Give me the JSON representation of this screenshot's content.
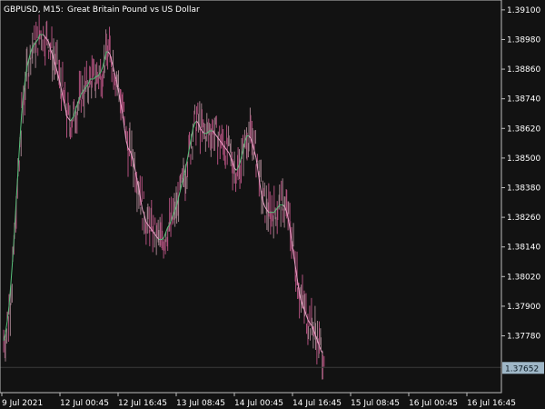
{
  "header": {
    "symbol": "GBPUSD, M15:",
    "description": "Great Britain Pound vs US Dollar"
  },
  "colors": {
    "background": "#121212",
    "axis": "#bdbdbd",
    "bar_up": "#a07f8a",
    "bar_down": "#b0507d",
    "ma_up": "#57c07a",
    "ma_down": "#e8a0c5",
    "price_line": "#3a3a3a",
    "price_tag": "#9fb7c7"
  },
  "price_axis": {
    "labels": [
      "1.39100",
      "1.38980",
      "1.38860",
      "1.38740",
      "1.38620",
      "1.38500",
      "1.38380",
      "1.38260",
      "1.38140",
      "1.38020",
      "1.37900",
      "1.37780"
    ]
  },
  "time_axis": {
    "labels": [
      "9 Jul 2021",
      "12 Jul 00:45",
      "12 Jul 16:45",
      "13 Jul 08:45",
      "14 Jul 00:45",
      "14 Jul 16:45",
      "15 Jul 08:45",
      "16 Jul 00:45",
      "16 Jul 16:45"
    ]
  },
  "current_price": "1.37652",
  "chart_data": {
    "type": "line",
    "ylim": [
      1.3755,
      1.3914
    ],
    "x": [
      0,
      2,
      4,
      6,
      8,
      10,
      12,
      14,
      16,
      18,
      20,
      22,
      24,
      26,
      28,
      30,
      32,
      34,
      36,
      38,
      40,
      42,
      44,
      46,
      48,
      50,
      52,
      54,
      56,
      58,
      60,
      62,
      64,
      66,
      68,
      70,
      72,
      74,
      76,
      78,
      80,
      82,
      84,
      86,
      88,
      90,
      92,
      94,
      96,
      98,
      100,
      102,
      104,
      106,
      108,
      110,
      112,
      114,
      116,
      118,
      120,
      122,
      124,
      126,
      128,
      130,
      132,
      134,
      136,
      138,
      140,
      142,
      144,
      146,
      148,
      150,
      152,
      154,
      156,
      158,
      160,
      162,
      164,
      166,
      168,
      170,
      172,
      174,
      176,
      178,
      180,
      182,
      184,
      186,
      188,
      190,
      192,
      194,
      196,
      198,
      200,
      202,
      204,
      206,
      208,
      210,
      212,
      214,
      216,
      218,
      220,
      222,
      224,
      226,
      228,
      230,
      232,
      234,
      236,
      238,
      240,
      242,
      244,
      246,
      248,
      250,
      252,
      254,
      256,
      258,
      260,
      262,
      264,
      266,
      268,
      270,
      272,
      274,
      276,
      278,
      280,
      282,
      284,
      286,
      288,
      290,
      292,
      294,
      296,
      298,
      300,
      302,
      304,
      306,
      308,
      310,
      312,
      314,
      316,
      318,
      320,
      322,
      324,
      326,
      328,
      330,
      332,
      334,
      336,
      338,
      340,
      342,
      344,
      346,
      348,
      350,
      352,
      354,
      356,
      358,
      360,
      362,
      364,
      366,
      368,
      370,
      372,
      374,
      376,
      378,
      380,
      382,
      384,
      386,
      388,
      390,
      392,
      394,
      396,
      398,
      400,
      402,
      404,
      406,
      408,
      410,
      412,
      414,
      416,
      418,
      420,
      422,
      424,
      426,
      428,
      430,
      432,
      434,
      436,
      438,
      440,
      442,
      444,
      446,
      448,
      450,
      452,
      454,
      456,
      458,
      460,
      462,
      464,
      466,
      468,
      470,
      472,
      474,
      476,
      478,
      480,
      482,
      484,
      486,
      488,
      490,
      492,
      494,
      496,
      498,
      500,
      502,
      504,
      506,
      508,
      510,
      512,
      514,
      516,
      518,
      520,
      522,
      524,
      526,
      528,
      530,
      532,
      534,
      536,
      538,
      540,
      542,
      544,
      546,
      548
    ],
    "series": [
      {
        "values": [
          1.3776,
          1.3779,
          1.3784,
          1.379,
          1.3799,
          1.3809,
          1.382,
          1.3833,
          1.3845,
          1.3857,
          1.3868,
          1.3876,
          1.3882,
          1.3887,
          1.389,
          1.3893,
          1.3895,
          1.3896,
          1.3897,
          1.3898,
          1.39,
          1.39,
          1.39,
          1.3899,
          1.3898,
          1.3897,
          1.3894,
          1.3892,
          1.3889,
          1.3887,
          1.3884,
          1.3881,
          1.3878,
          1.3874,
          1.3871,
          1.3867,
          1.3866,
          1.3865,
          1.3866,
          1.3867,
          1.387,
          1.3872,
          1.3874,
          1.3876,
          1.3877,
          1.3878,
          1.3879,
          1.388,
          1.3882,
          1.3882,
          1.3882,
          1.3883,
          1.3883,
          1.3884,
          1.3885,
          1.3887,
          1.389,
          1.3893,
          1.3893,
          1.3892,
          1.3889,
          1.3886,
          1.3883,
          1.388,
          1.3876,
          1.3872,
          1.3868,
          1.3862,
          1.3857,
          1.3854,
          1.3853,
          1.3851,
          1.3848,
          1.3845,
          1.3841,
          1.3838,
          1.3833,
          1.3829,
          1.3827,
          1.3824,
          1.3823,
          1.3822,
          1.3821,
          1.382,
          1.3819,
          1.3818,
          1.3817,
          1.3817,
          1.3817,
          1.3818,
          1.382,
          1.3822,
          1.3823,
          1.3825,
          1.3827,
          1.3829,
          1.3831,
          1.3834,
          1.3837,
          1.384,
          1.3843,
          1.3846,
          1.385,
          1.3854,
          1.3858,
          1.3862,
          1.3864,
          1.3865,
          1.3864,
          1.3862,
          1.3861,
          1.386,
          1.386,
          1.386,
          1.3861,
          1.3861,
          1.3861,
          1.386,
          1.3859,
          1.3858,
          1.3857,
          1.3856,
          1.3855,
          1.3854,
          1.3853,
          1.3852,
          1.385,
          1.3848,
          1.3846,
          1.3845,
          1.3846,
          1.3848,
          1.3851,
          1.3854,
          1.3857,
          1.3859,
          1.3859,
          1.3858,
          1.3856,
          1.3853,
          1.385,
          1.3845,
          1.384,
          1.3835,
          1.3832,
          1.383,
          1.3829,
          1.3828,
          1.3828,
          1.3828,
          1.3828,
          1.3829,
          1.383,
          1.3831,
          1.3831,
          1.3831,
          1.383,
          1.3828,
          1.3825,
          1.382,
          1.3815,
          1.381,
          1.3805,
          1.38,
          1.3795,
          1.3792,
          1.379,
          1.3788,
          1.3786,
          1.3784,
          1.3783,
          1.3782,
          1.378,
          1.3778,
          1.3776,
          1.3774,
          1.3772,
          1.3771
        ],
        "color": "#e8a0c5"
      }
    ],
    "title": "",
    "xlabel": "",
    "ylabel": ""
  }
}
